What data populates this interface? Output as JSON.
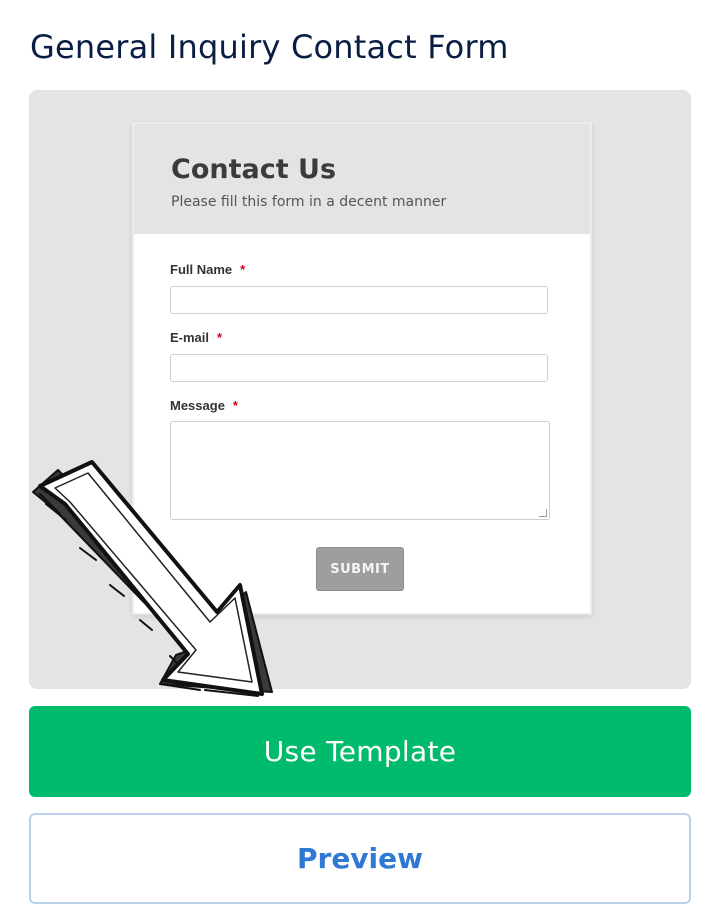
{
  "card": {
    "title": "General Inquiry Contact Form"
  },
  "form_preview": {
    "heading": "Contact Us",
    "subheading": "Please fill this form in a decent manner",
    "fields": [
      {
        "label": "Full Name",
        "required_marker": "*"
      },
      {
        "label": "E-mail",
        "required_marker": "*"
      },
      {
        "label": "Message",
        "required_marker": "*"
      }
    ],
    "submit_label": "SUBMIT"
  },
  "actions": {
    "use_template_label": "Use Template",
    "preview_label": "Preview"
  },
  "colors": {
    "title": "#0a1e44",
    "primary_green": "#00bb6c",
    "preview_blue": "#2f78d4",
    "preview_border": "#b9d2ea",
    "required_red": "#d0021b"
  },
  "icons": {
    "overlay_arrow": "hand-drawn-arrow-icon"
  }
}
